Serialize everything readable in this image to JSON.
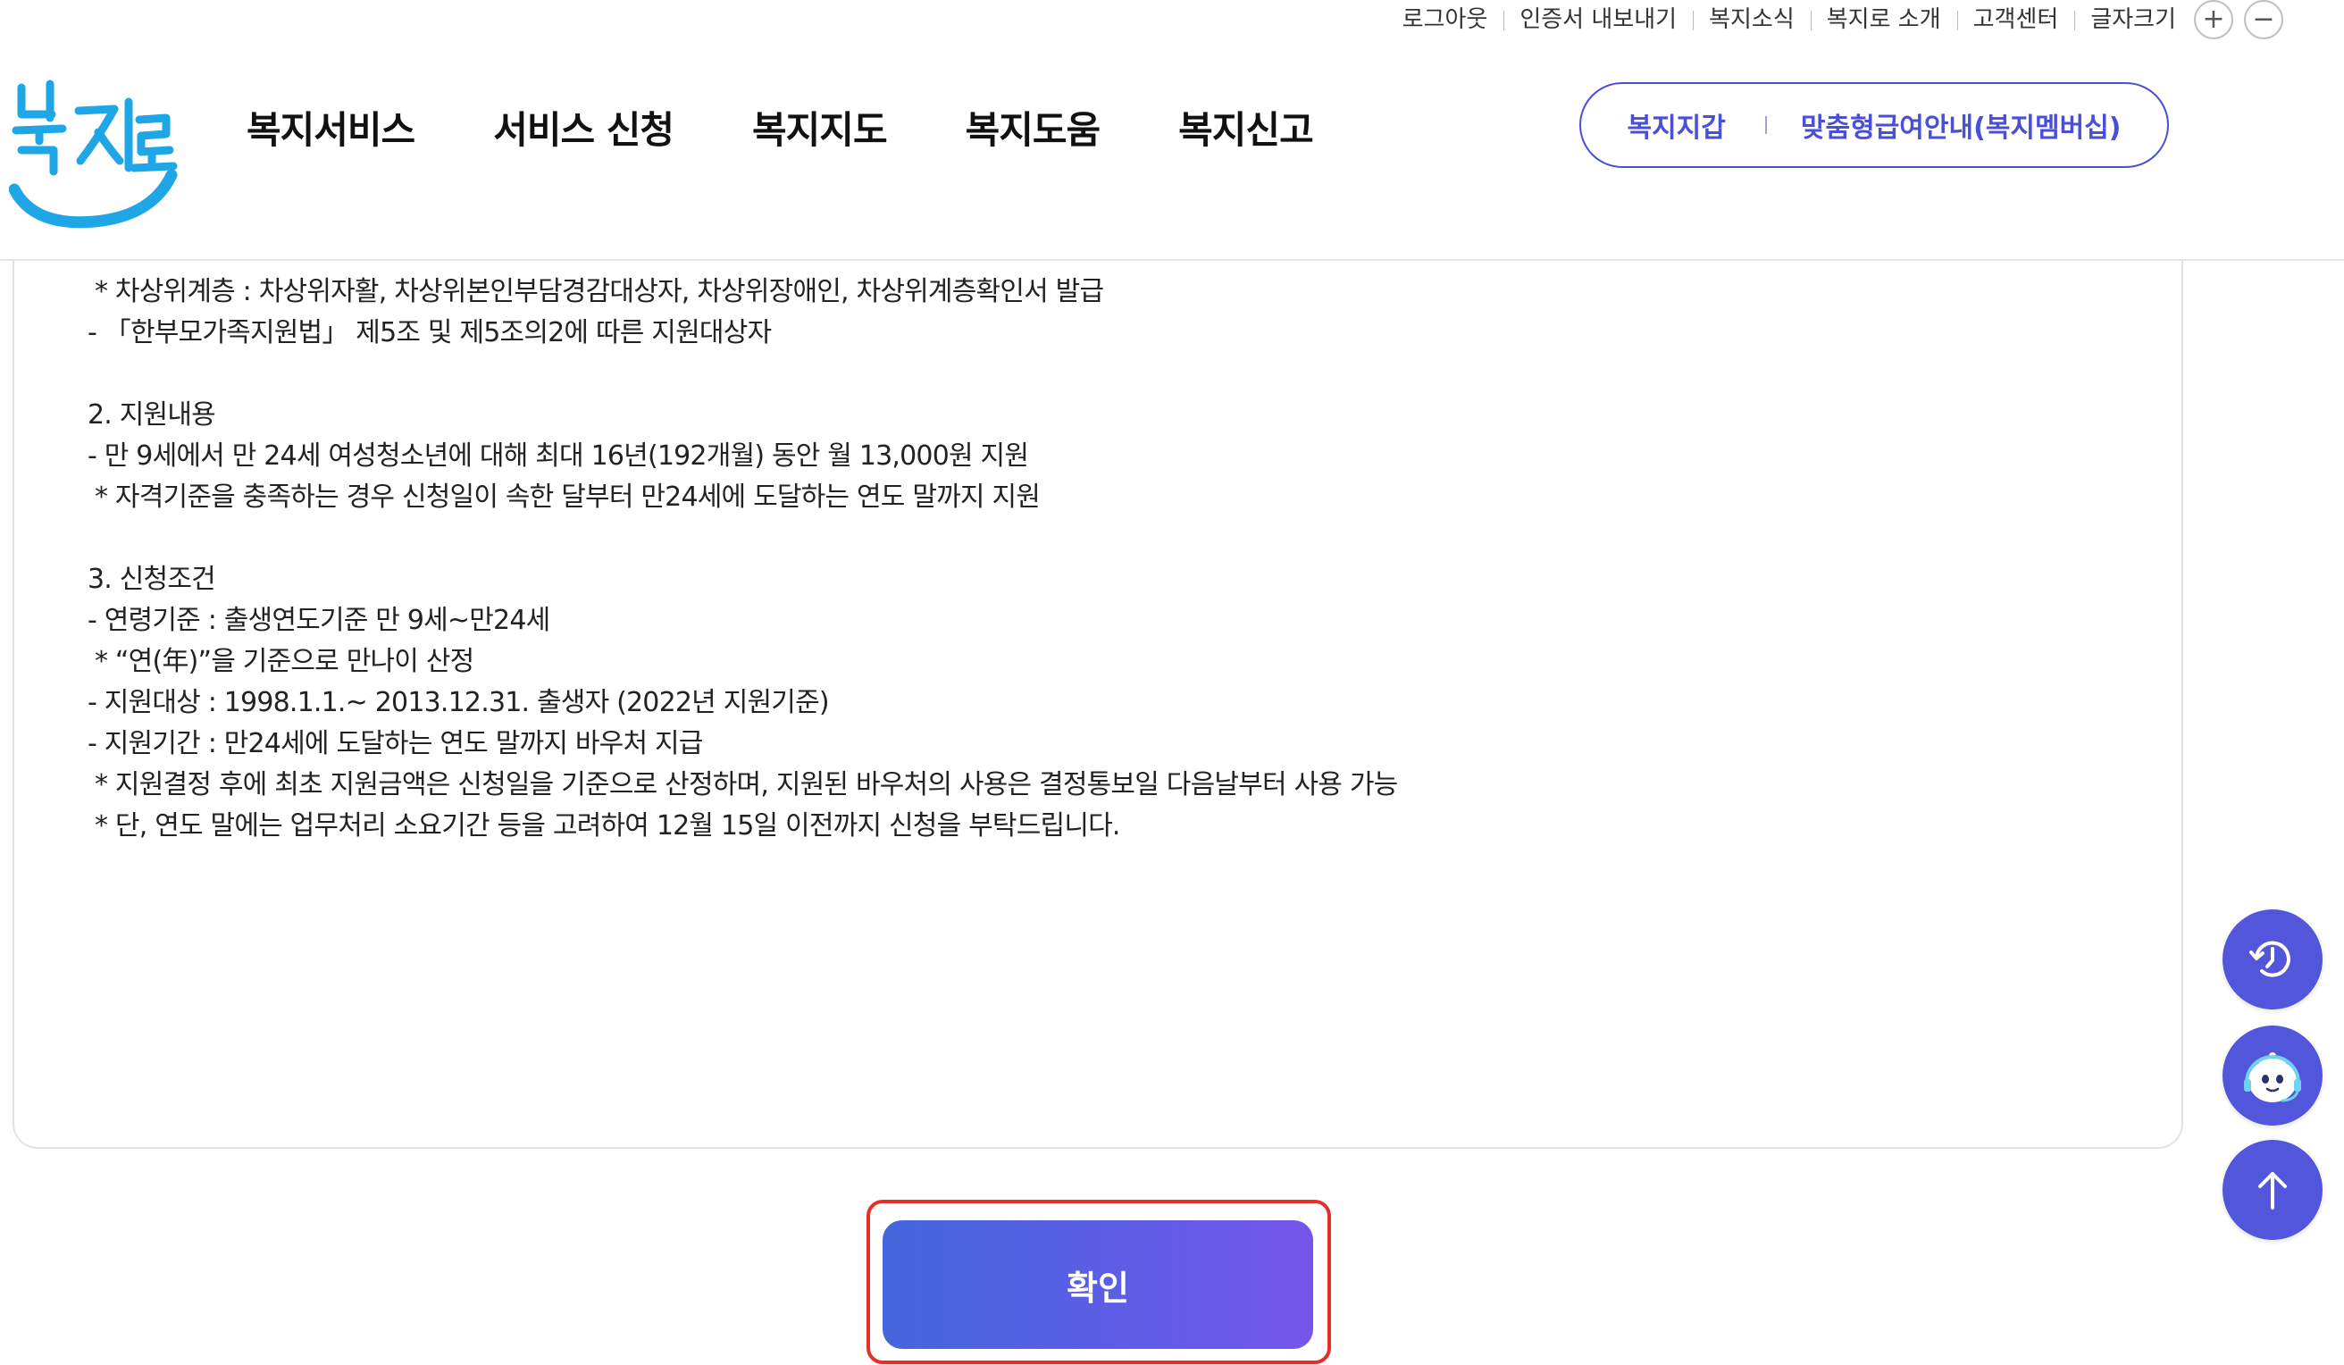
{
  "utility": {
    "links": [
      "로그아웃",
      "인증서 내보내기",
      "복지소식",
      "복지로 소개",
      "고객센터"
    ],
    "font_size_label": "글자크기",
    "font_plus": "+",
    "font_minus": "−"
  },
  "header": {
    "logo_text": "복지로",
    "gnb": [
      "복지서비스",
      "서비스 신청",
      "복지지도",
      "복지도움",
      "복지신고"
    ],
    "pill_links": [
      "복지지갑",
      "맞춤형급여안내(복지멤버십)"
    ]
  },
  "content": {
    "lines": [
      "* 차상위계층 : 차상위자활, 차상위본인부담경감대상자, 차상위장애인, 차상위계층확인서 발급",
      "- 「한부모가족지원법」 제5조 및 제5조의2에 따른 지원대상자",
      "",
      "2. 지원내용",
      "- 만 9세에서 만 24세 여성청소년에 대해 최대 16년(192개월) 동안 월 13,000원 지원",
      "* 자격기준을 충족하는 경우 신청일이 속한 달부터 만24세에 도달하는 연도 말까지 지원",
      "",
      "3. 신청조건",
      "- 연령기준 : 출생연도기준 만 9세~만24세",
      "* “연(年)”을 기준으로 만나이 산정",
      "- 지원대상 : 1998.1.1.~ 2013.12.31. 출생자 (2022년 지원기준)",
      "- 지원기간 : 만24세에 도달하는 연도 말까지 바우처 지급",
      "* 지원결정 후에 최초 지원금액은 신청일을 기준으로 산정하며, 지원된 바우처의 사용은 결정통보일 다음날부터 사용 가능",
      "* 단, 연도 말에는 업무처리 소요기간 등을 고려하여 12월 15일 이전까지 신청을 부탁드립니다."
    ]
  },
  "confirm_label": "확인",
  "colors": {
    "accent": "#5156db",
    "highlight_outline": "#e5302a",
    "logo_blue": "#1fa6e6"
  },
  "icons": {
    "history": "history-clock-icon",
    "chatbot": "chatbot-face-icon",
    "top": "arrow-up-icon"
  }
}
